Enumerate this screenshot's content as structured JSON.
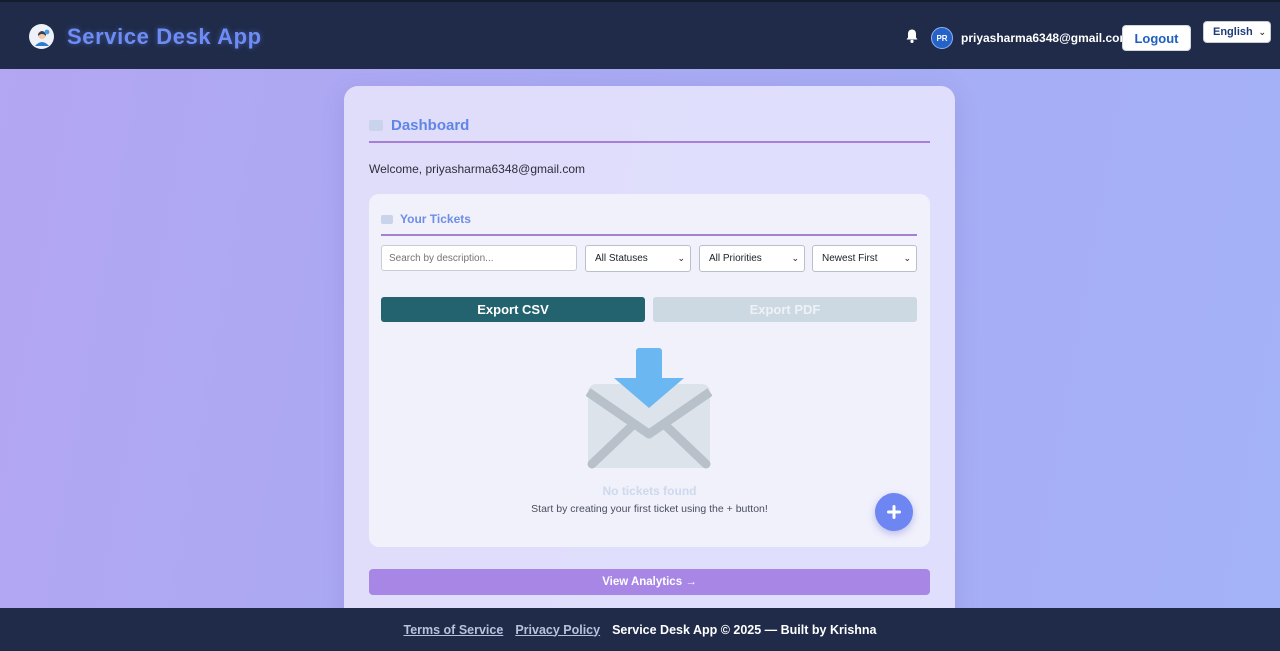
{
  "header": {
    "app_title": "Service Desk App",
    "avatar_initials": "PR",
    "user_email": "priyasharma6348@gmail.com",
    "logout_label": "Logout",
    "language_selected": "English"
  },
  "dashboard": {
    "title": "Dashboard",
    "welcome_text": "Welcome, priyasharma6348@gmail.com"
  },
  "tickets": {
    "title": "Your Tickets",
    "search_placeholder": "Search by description...",
    "status_filter": "All Statuses",
    "priority_filter": "All Priorities",
    "sort_order": "Newest First",
    "export_csv_label": "Export CSV",
    "export_pdf_label": "Export PDF",
    "empty_title": "No tickets found",
    "empty_subtitle": "Start by creating your first ticket using the + button!"
  },
  "analytics_label": "View Analytics →",
  "footer": {
    "terms_label": "Terms of Service",
    "privacy_label": "Privacy Policy",
    "copyright": "Service Desk App © 2025 — Built by Krishna"
  },
  "colors": {
    "navbar": "#1f2b49",
    "brand": "#6e8cf5",
    "export_csv": "#22636f",
    "analytics": "#a886e6",
    "fab": "#6d86f1"
  },
  "icons": [
    "app-logo-icon",
    "bell-icon",
    "dashboard-icon",
    "tickets-icon",
    "empty-inbox-icon",
    "plus-icon",
    "chevron-down-icon"
  ]
}
